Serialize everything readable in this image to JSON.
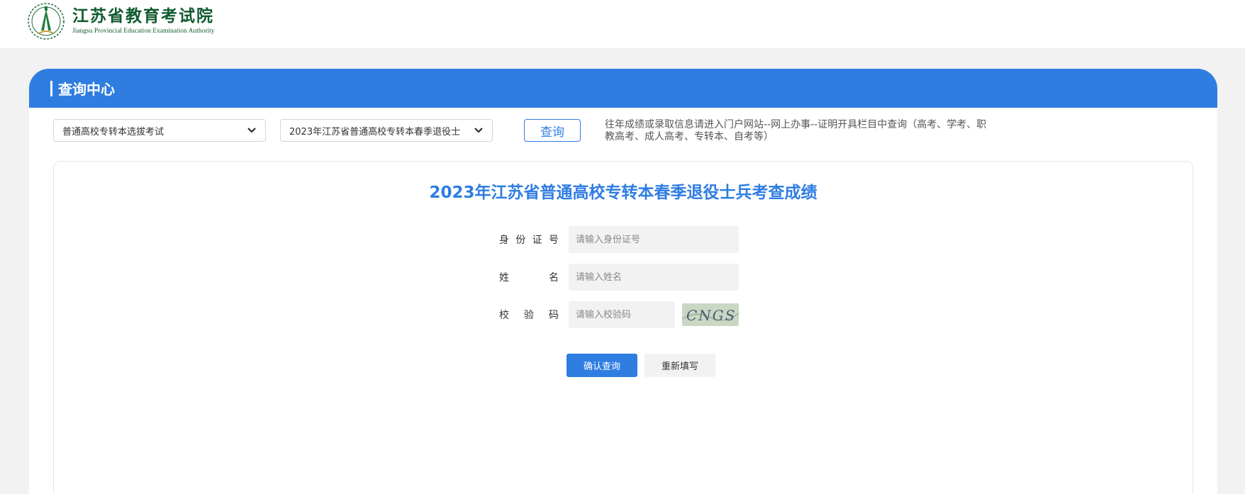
{
  "header": {
    "logo_cn": "江苏省教育考试院",
    "logo_en": "Jiangsu Provincial Education Examination Authority"
  },
  "panel": {
    "title": "查询中心"
  },
  "filters": {
    "exam_type": "普通高校专转本选拔考试",
    "exam_session": "2023年江苏省普通高校专转本春季退役士",
    "query_label": "查询",
    "notice": "往年成绩或录取信息请进入门户网站--网上办事--证明开具栏目中查询（高考、学考、职教高考、成人高考、专转本、自考等）"
  },
  "form": {
    "title": "2023年江苏省普通高校专转本春季退役士兵考查成绩",
    "id_label": [
      "身",
      "份",
      "证",
      "号"
    ],
    "id_placeholder": "请输入身份证号",
    "name_label": [
      "姓",
      "名"
    ],
    "name_placeholder": "请输入姓名",
    "captcha_label": [
      "校",
      "验",
      "码"
    ],
    "captcha_placeholder": "请输入校验码",
    "captcha_text": "CNGS",
    "confirm_label": "确认查询",
    "reset_label": "重新填写"
  }
}
